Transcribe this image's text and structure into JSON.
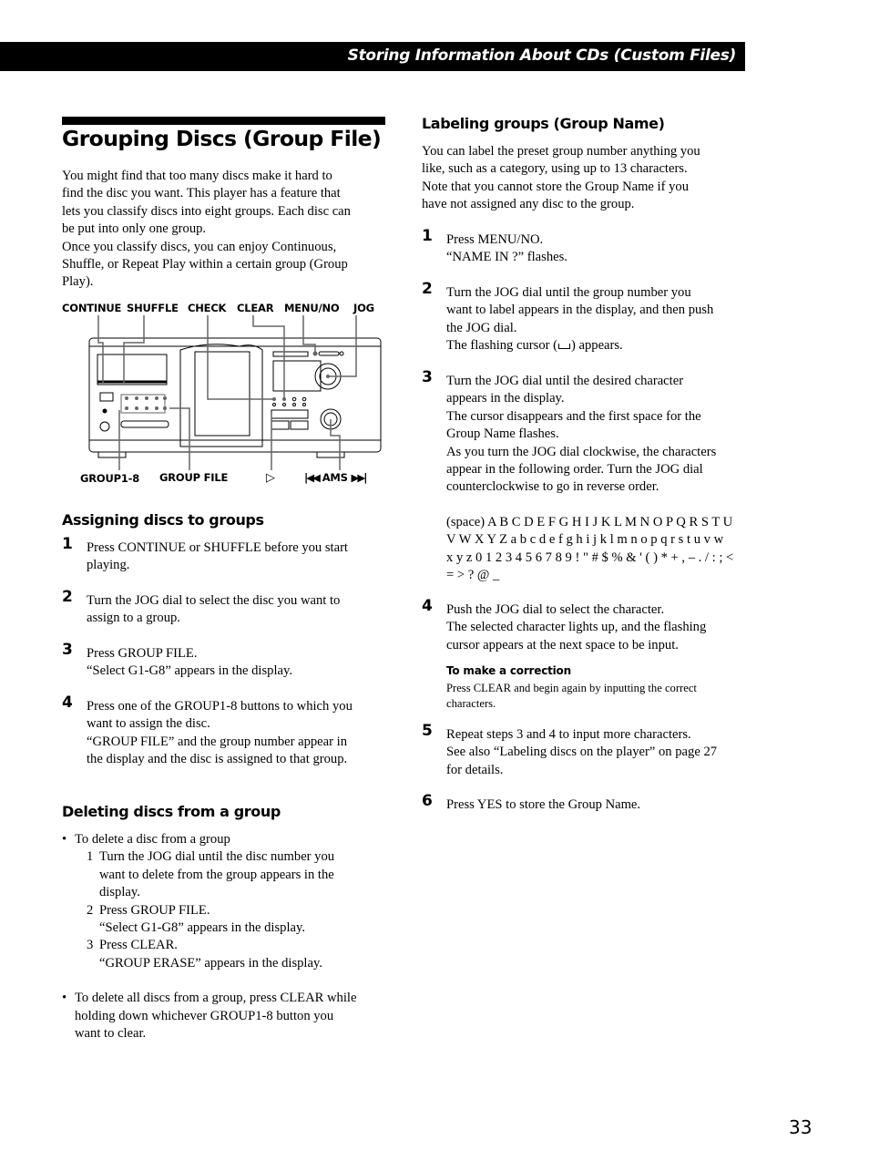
{
  "header": {
    "section_title": "Storing Information About CDs (Custom Files)"
  },
  "page": {
    "title": "Grouping Discs (Group File)",
    "number": "33"
  },
  "intro": {
    "lines": [
      "You might find that too many discs make it hard to",
      "find the disc you want. This player has a feature that",
      "lets you classify discs into eight groups. Each disc can",
      "be put into only one group.",
      "Once you classify discs, you can enjoy Continuous,",
      "Shuffle, or Repeat Play within a certain group (Group",
      "Play)."
    ]
  },
  "diagram": {
    "top_labels": [
      "CONTINUE",
      "SHUFFLE",
      "CHECK",
      "CLEAR",
      "MENU/NO",
      "JOG"
    ],
    "bottom_labels": [
      "GROUP1-8",
      "GROUP FILE",
      "▷",
      "⏮ AMS ⏭"
    ],
    "play_symbol": "▷",
    "ams_label": "AMS",
    "ams_prev_symbol": "|◀◀",
    "ams_next_symbol": "▶▶|"
  },
  "assigning": {
    "heading": "Assigning discs to groups",
    "steps": [
      {
        "num": "1",
        "lines": [
          "Press CONTINUE or SHUFFLE before you start",
          "playing."
        ]
      },
      {
        "num": "2",
        "lines": [
          "Turn the JOG dial to select the disc you want to",
          "assign to a group."
        ]
      },
      {
        "num": "3",
        "lines": [
          "Press GROUP FILE.",
          "“Select G1-G8” appears in the display."
        ]
      },
      {
        "num": "4",
        "lines": [
          "Press one of the GROUP1-8 buttons to which you",
          "want to assign the disc.",
          "“GROUP FILE” and the group number appear in",
          "the display and the disc is assigned to that group."
        ]
      }
    ]
  },
  "deleting": {
    "heading": "Deleting discs from a group",
    "bullet1": "To delete a disc from a group",
    "substeps": [
      {
        "n": "1",
        "lines": [
          "Turn the JOG dial until the disc number you",
          "want to delete from the group appears in the",
          "display."
        ]
      },
      {
        "n": "2",
        "lines": [
          "Press GROUP FILE.",
          "“Select G1-G8” appears in the display."
        ]
      },
      {
        "n": "3",
        "lines": [
          "Press CLEAR.",
          "“GROUP ERASE” appears in the display."
        ]
      }
    ],
    "bullet2_lines": [
      "To delete all discs from a group, press CLEAR while",
      "holding down whichever GROUP1-8 button you",
      "want to clear."
    ]
  },
  "labeling": {
    "heading": "Labeling groups (Group Name)",
    "intro_lines": [
      "You can label the preset group number anything you",
      "like, such as a category, using up to 13 characters.",
      "Note that you cannot store the Group Name if you",
      "have not assigned any disc to the group."
    ],
    "step1": {
      "num": "1",
      "lines": [
        "Press MENU/NO.",
        "“NAME IN ?” flashes."
      ]
    },
    "step2": {
      "num": "2",
      "lines": [
        "Turn the JOG dial until the group number you",
        "want to label appears in the display, and then push",
        "the JOG dial."
      ],
      "cursor_line_before": "The flashing cursor (",
      "cursor_line_after": ") appears."
    },
    "step3": {
      "num": "3",
      "lines": [
        "Turn the JOG dial until the desired character",
        "appears in the display.",
        "The cursor disappears and the first space for the",
        "Group Name flashes.",
        "As you turn the JOG dial clockwise, the characters",
        "appear in the following order. Turn the JOG dial",
        "counterclockwise to go in reverse order."
      ],
      "charset_lines": [
        "(space) A B C D E F G H I J K L M N O P Q R S T U",
        "V W X Y Z a b c d e f g h i j k l m n o p q r s t u v w",
        "x y z 0 1 2 3 4 5 6 7 8 9 ! \" # $ % & ' ( ) * + , – . / : ; <",
        "= > ? @ _"
      ]
    },
    "step4": {
      "num": "4",
      "lines": [
        "Push the JOG dial to select the character.",
        "The selected character lights up, and the flashing",
        "cursor appears at the next space to be input."
      ]
    },
    "correction": {
      "heading": "To make a correction",
      "lines": [
        "Press CLEAR and begin again by inputting the correct",
        "characters."
      ]
    },
    "step5": {
      "num": "5",
      "lines": [
        "Repeat steps 3 and 4 to input more characters.",
        "See also “Labeling discs on the player” on page 27",
        "for details."
      ]
    },
    "step6": {
      "num": "6",
      "lines": [
        "Press YES to store the Group Name."
      ]
    }
  }
}
